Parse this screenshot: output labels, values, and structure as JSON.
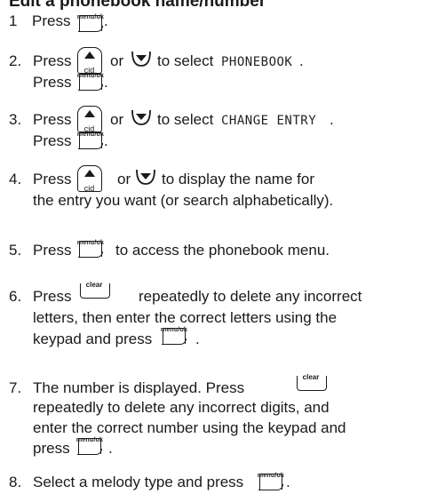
{
  "title": "Edit a phonebook name/number",
  "keys": {
    "menu_ok": "menu/ok",
    "clear": "clear",
    "cid": "cid"
  },
  "steps": [
    {
      "num": "1",
      "press": "Press",
      "end": "."
    },
    {
      "num": "2.",
      "press": "Press",
      "or": "or",
      "select": "to select",
      "lcd": "PHONEBOOK",
      "end": ".",
      "press2": "Press",
      "end2": "."
    },
    {
      "num": "3.",
      "press": "Press",
      "or": "or",
      "select": "to select",
      "lcd": "CHANGE ENTRY",
      "end": ".",
      "press2": "Press",
      "end2": "."
    },
    {
      "num": "4.",
      "press": "Press",
      "or": "or",
      "line1": "to display the name for",
      "line2": "the entry you want (or search alphabetically)."
    },
    {
      "num": "5.",
      "press": "Press",
      "rest": "to access the phonebook menu."
    },
    {
      "num": "6.",
      "press": "Press",
      "rest": "repeatedly to delete any incorrect",
      "line2": "letters, then enter the correct letters using the",
      "line3": "keypad and press",
      "end": "."
    },
    {
      "num": "7.",
      "line1": "The number is displayed. Press",
      "line2": "repeatedly to delete any incorrect digits, and",
      "line3": "enter the correct number using the keypad and",
      "line4": "press",
      "end": "."
    },
    {
      "num": "8.",
      "line1": "Select a melody type and press",
      "end": "."
    }
  ]
}
